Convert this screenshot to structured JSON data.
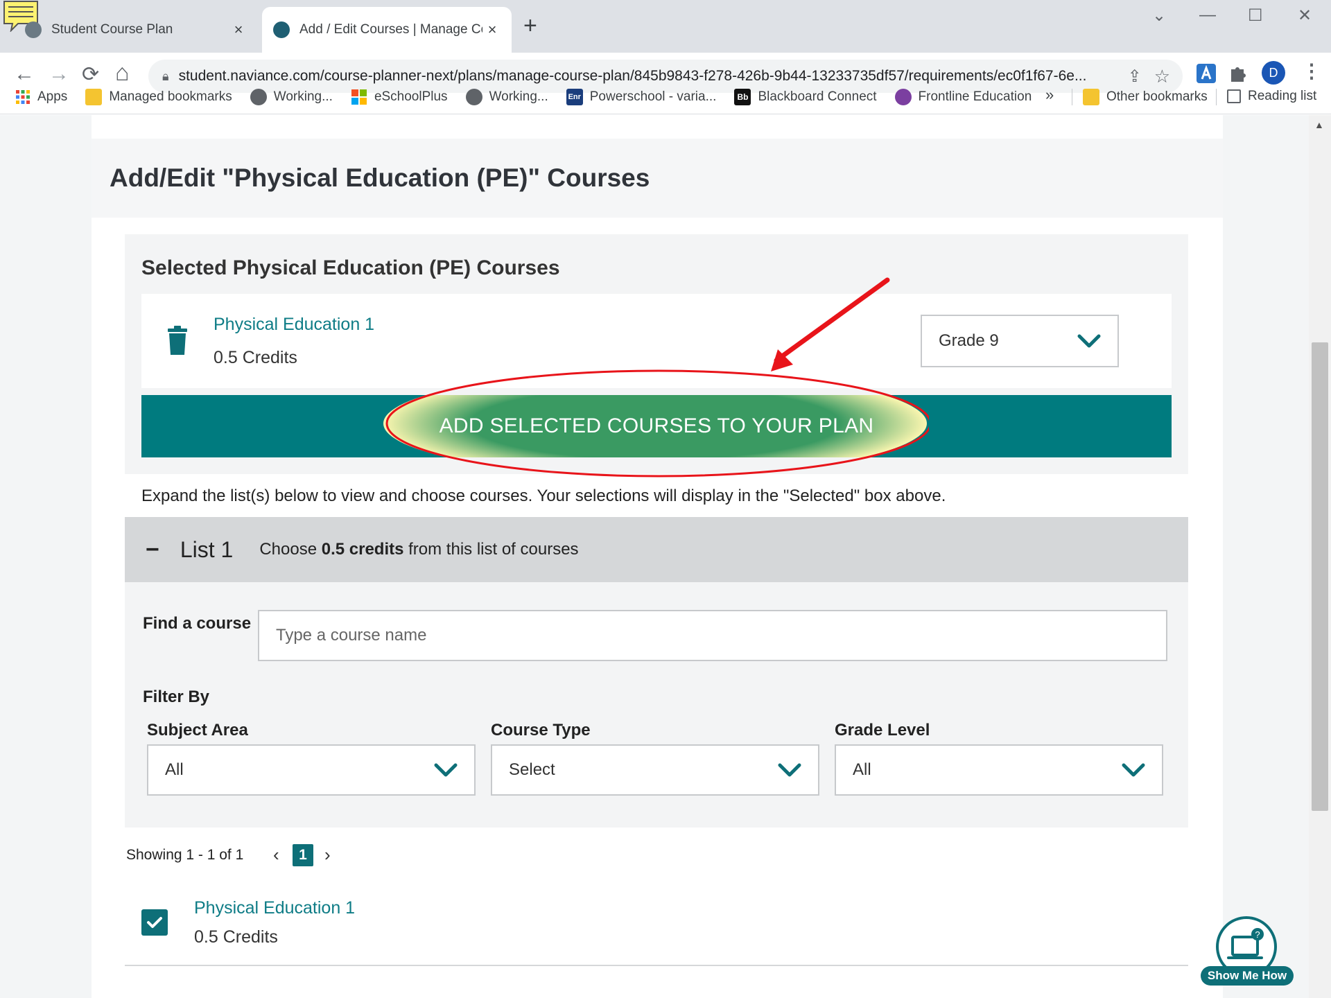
{
  "browser": {
    "tabs": [
      {
        "title": "Student Course Plan",
        "close": "×"
      },
      {
        "title": "Add / Edit Courses | Manage Course Plan",
        "close": "×"
      }
    ],
    "new_tab": "+",
    "window_controls": {
      "dropdown": "⌄",
      "minimize": "—",
      "maximize": "☐",
      "close": "✕"
    },
    "nav": {
      "back": "←",
      "forward": "→",
      "reload": "⟳",
      "home": "⌂"
    },
    "url": "student.naviance.com/course-planner-next/plans/manage-course-plan/845b9843-f278-426b-9b44-13233735df57/requirements/ec0f1f67-6e...",
    "profile_initial": "D",
    "menu": "⋮",
    "bookmarks": [
      {
        "label": "Apps",
        "icon": "apps-grid-icon",
        "color": "#ea4335"
      },
      {
        "label": "Managed bookmarks",
        "icon": "folder-icon",
        "color": "#f4c430"
      },
      {
        "label": "Working...",
        "icon": "globe-icon",
        "color": "#5f6368"
      },
      {
        "label": "eSchoolPlus",
        "icon": "windows-logo-icon",
        "color": "#0078d4"
      },
      {
        "label": "Working...",
        "icon": "globe-icon",
        "color": "#5f6368"
      },
      {
        "label": "Powerschool - varia...",
        "icon": "enr-icon",
        "color": "#1a3d7c"
      },
      {
        "label": "Blackboard Connect",
        "icon": "bb-icon",
        "color": "#111111"
      },
      {
        "label": "Frontline Education",
        "icon": "frontline-icon",
        "color": "#7b3fa0"
      }
    ],
    "bookmarks_overflow": "»",
    "other_bookmarks": "Other bookmarks",
    "reading_list": "Reading list",
    "bookmark_badges": {
      "enr": "Enr",
      "bb": "Bb"
    }
  },
  "page": {
    "heading": "Add/Edit \"Physical Education (PE)\" Courses",
    "selected": {
      "title": "Selected Physical Education (PE) Courses",
      "course_name": "Physical Education 1",
      "course_credits": "0.5 Credits",
      "grade_value": "Grade 9"
    },
    "add_button": "ADD SELECTED COURSES TO YOUR PLAN",
    "instructions": "Expand the list(s) below to view and choose courses. Your selections will display in the \"Selected\" box above.",
    "list": {
      "toggle": "−",
      "title": "List 1",
      "desc_prefix": "Choose ",
      "desc_bold": "0.5 credits",
      "desc_suffix": " from this list of courses"
    },
    "find": {
      "label": "Find a course",
      "placeholder": "Type a course name"
    },
    "filter": {
      "title": "Filter By",
      "subject": {
        "label": "Subject Area",
        "value": "All"
      },
      "type": {
        "label": "Course Type",
        "value": "Select"
      },
      "grade": {
        "label": "Grade Level",
        "value": "All"
      }
    },
    "pagination": {
      "showing": "Showing 1 - 1 of 1",
      "prev": "‹",
      "page": "1",
      "next": "›"
    },
    "result": {
      "course_name": "Physical Education 1",
      "course_credits": "0.5 Credits"
    },
    "show_me_how": "Show Me How"
  },
  "colors": {
    "teal": "#007b7f",
    "link": "#0e7c86",
    "annotation_red": "#e8141a",
    "highlight_yellow": "#fbf6b0",
    "highlight_green": "#3a9a62"
  }
}
